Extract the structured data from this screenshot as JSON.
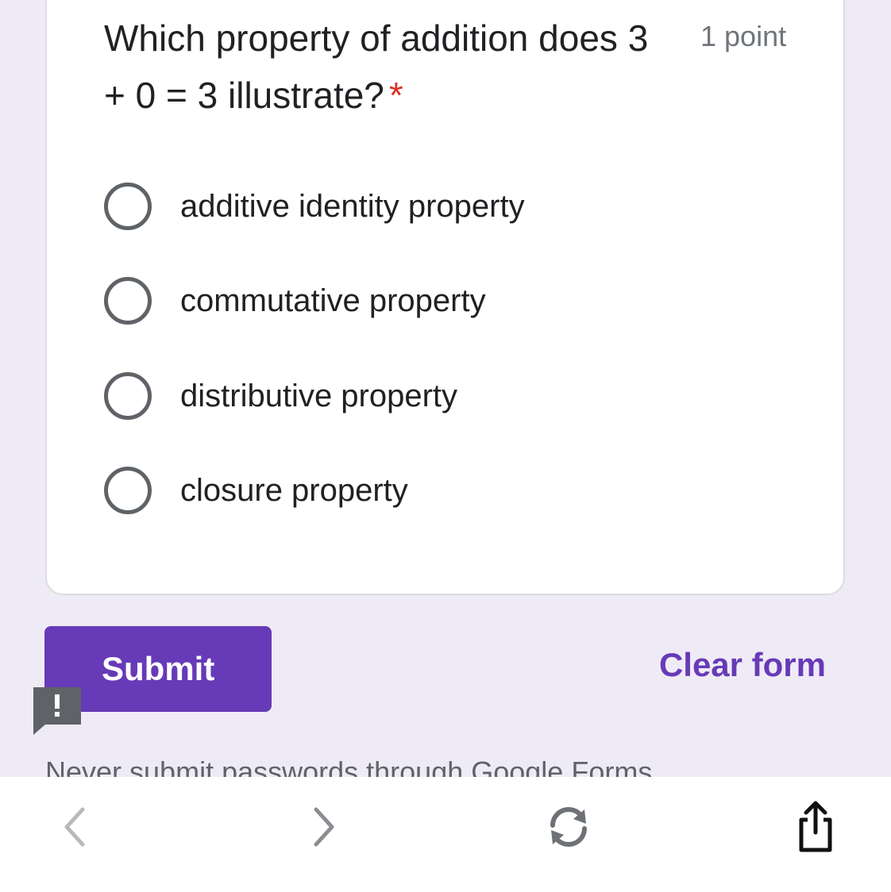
{
  "question": {
    "text": "Which property of addition does 3 + 0 = 3 illustrate?",
    "required_marker": "*",
    "points": "1 point"
  },
  "options": [
    {
      "label": "additive identity property"
    },
    {
      "label": "commutative property"
    },
    {
      "label": "distributive property"
    },
    {
      "label": "closure property"
    }
  ],
  "actions": {
    "submit_label": "Submit",
    "clear_label": "Clear form"
  },
  "footer": {
    "notice": "Never submit passwords through Google Forms."
  },
  "browser_toolbar": {
    "icons": [
      "back-icon",
      "forward-icon",
      "reload-icon",
      "share-icon"
    ]
  },
  "colors": {
    "accent": "#673ab7",
    "background": "#efebf6",
    "required": "#d93025"
  }
}
